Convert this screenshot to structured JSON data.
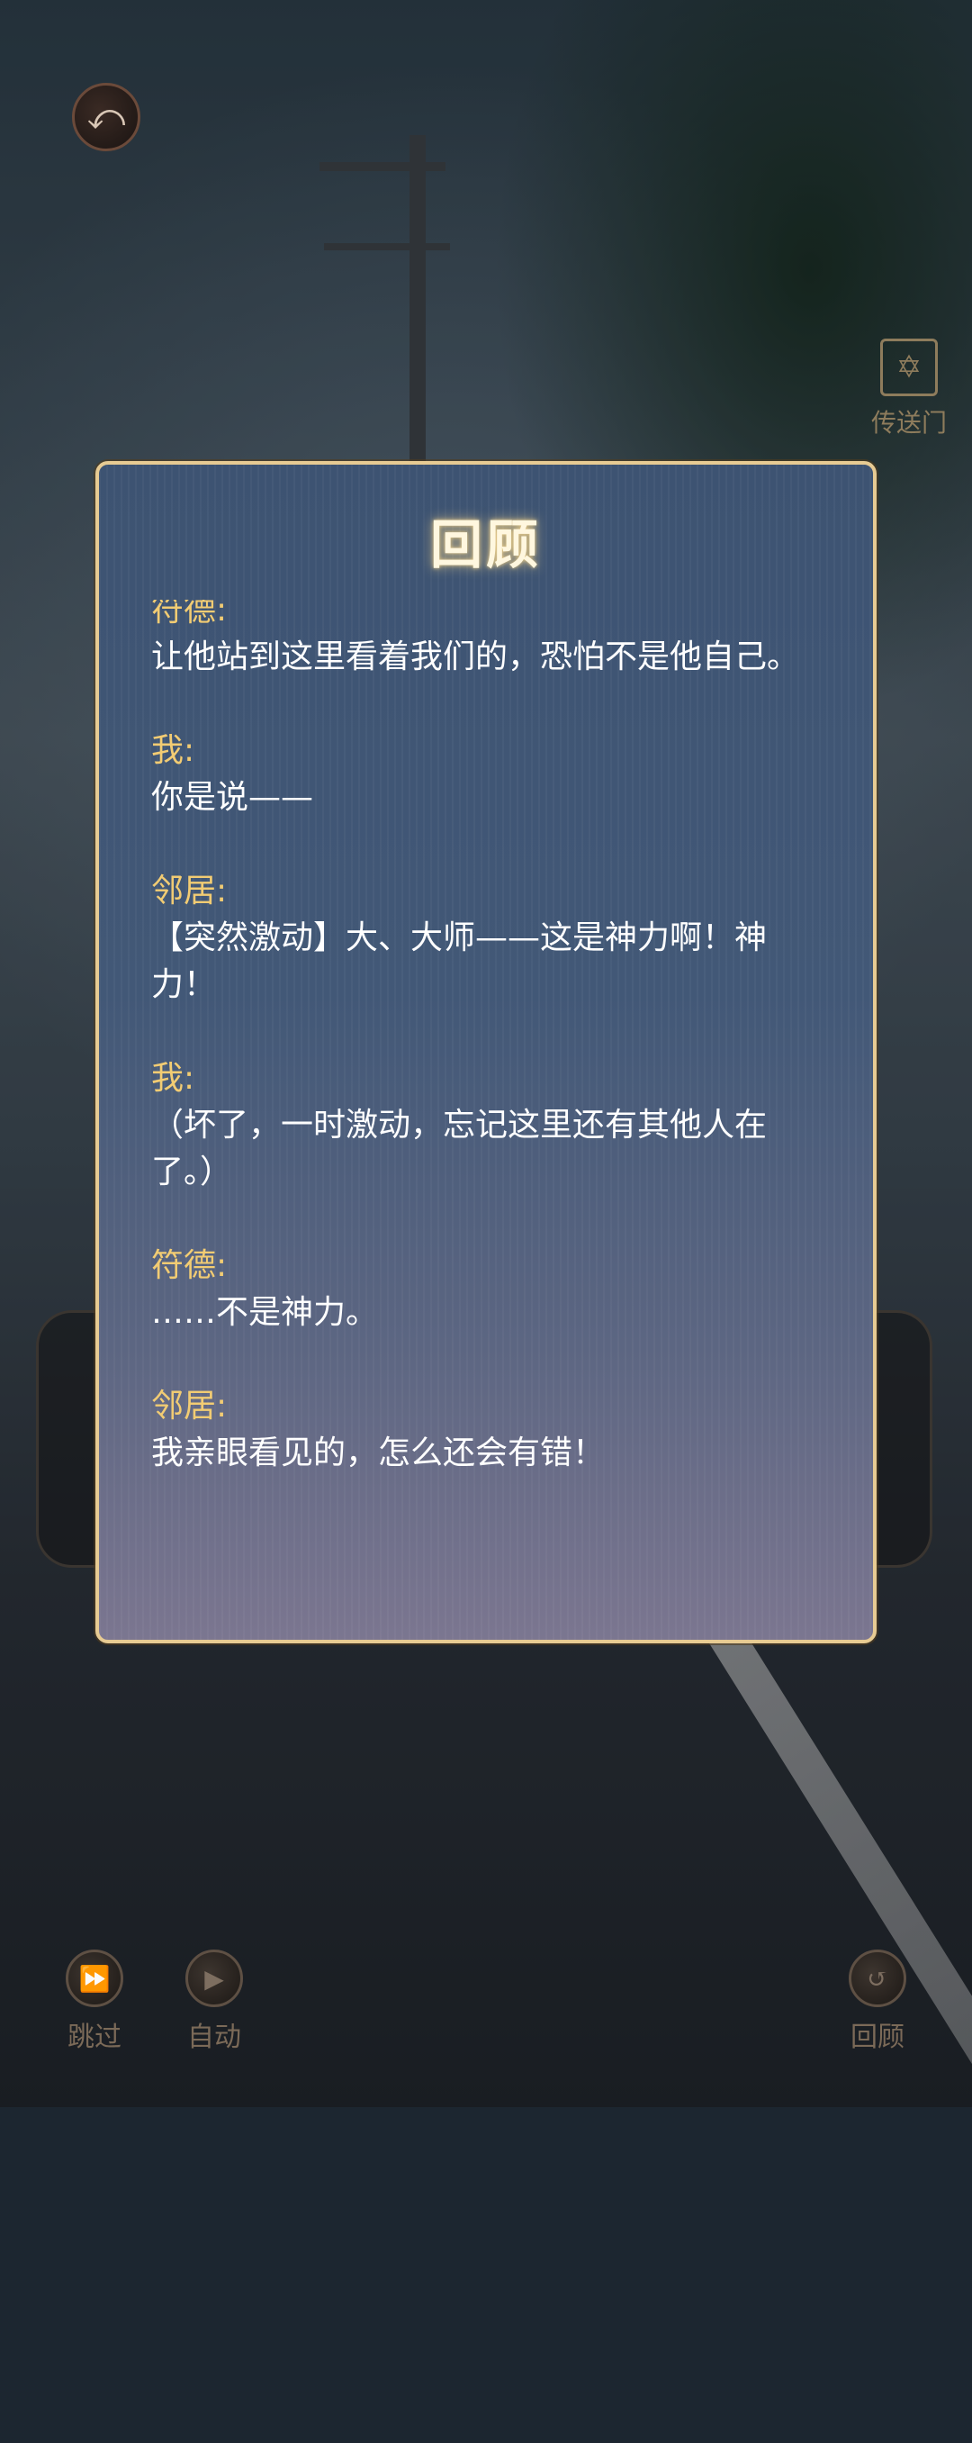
{
  "top_bar": {
    "back_icon": "back-arrow-icon",
    "portal_label": "传送门"
  },
  "review": {
    "title": "回顾",
    "entries": [
      {
        "speaker": "符德:",
        "text": "让他站到这里看着我们的，恐怕不是他自己。"
      },
      {
        "speaker": "我:",
        "text": "你是说——"
      },
      {
        "speaker": "邻居:",
        "text": "【突然激动】大、大师——这是神力啊！神力！"
      },
      {
        "speaker": "我:",
        "text": "（坏了，一时激动，忘记这里还有其他人在了。）"
      },
      {
        "speaker": "符德:",
        "text": "……不是神力。"
      },
      {
        "speaker": "邻居:",
        "text": "我亲眼看见的，怎么还会有错！"
      }
    ]
  },
  "controls": {
    "skip_label": "跳过",
    "auto_label": "自动",
    "review_label": "回顾"
  },
  "colors": {
    "speaker": "#f2cc73",
    "panel_border": "#e7cb93",
    "panel_bg": "#425877"
  }
}
